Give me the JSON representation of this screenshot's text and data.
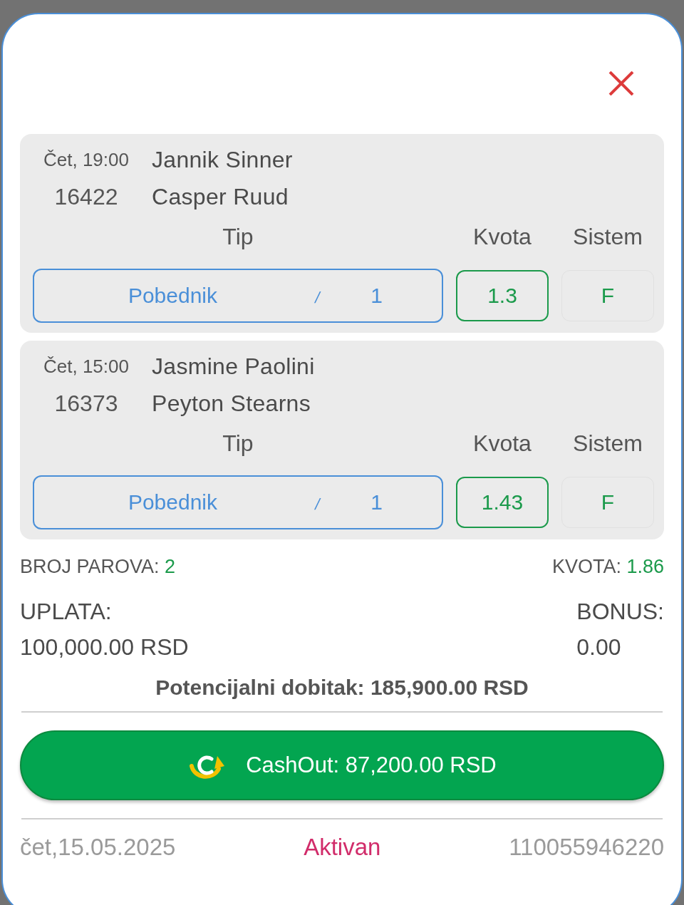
{
  "matches": [
    {
      "time": "Čet, 19:00",
      "code": "16422",
      "home": "Jannik Sinner",
      "away": "Casper Ruud",
      "column_headers": [
        "Tip",
        "Kvota",
        "Sistem"
      ],
      "tip": {
        "market": "Pobednik",
        "separator": "/",
        "outcome": "1"
      },
      "odds": "1.3",
      "system": "F"
    },
    {
      "time": "Čet, 15:00",
      "code": "16373",
      "home": "Jasmine Paolini",
      "away": "Peyton Stearns",
      "column_headers": [
        "Tip",
        "Kvota",
        "Sistem"
      ],
      "tip": {
        "market": "Pobednik",
        "separator": "/",
        "outcome": "1"
      },
      "odds": "1.43",
      "system": "F"
    }
  ],
  "summary": {
    "pairs_label": "BROJ PAROVA:",
    "pairs_value": "2",
    "odds_label": "KVOTA:",
    "odds_value": "1.86"
  },
  "stake": {
    "label": "UPLATA:",
    "value": "100,000.00 RSD"
  },
  "bonus": {
    "label": "BONUS:",
    "value": "0.00"
  },
  "potential_win": "Potencijalni dobitak: 185,900.00 RSD",
  "cashout_button": {
    "label": "CashOut: 87,200.00 RSD"
  },
  "footer": {
    "date": "čet,15.05.2025",
    "status": "Aktivan",
    "ticket_id": "110055946220"
  }
}
